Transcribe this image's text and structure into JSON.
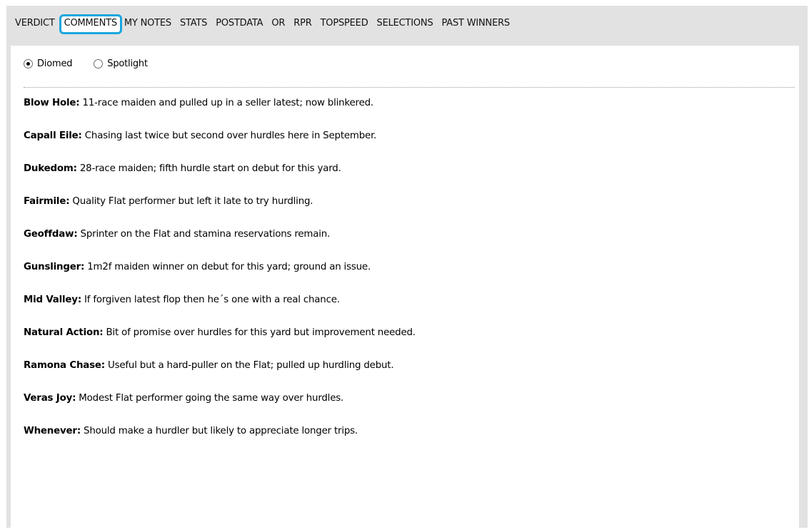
{
  "tabs": [
    {
      "label": "VERDICT",
      "selected": false
    },
    {
      "label": "COMMENTS",
      "selected": true
    },
    {
      "label": "MY NOTES",
      "selected": false
    },
    {
      "label": "STATS",
      "selected": false
    },
    {
      "label": "POSTDATA",
      "selected": false
    },
    {
      "label": "OR",
      "selected": false
    },
    {
      "label": "RPR",
      "selected": false
    },
    {
      "label": "TOPSPEED",
      "selected": false
    },
    {
      "label": "SELECTIONS",
      "selected": false
    },
    {
      "label": "PAST WINNERS",
      "selected": false
    }
  ],
  "source_options": [
    {
      "label": "Diomed",
      "checked": true
    },
    {
      "label": "Spotlight",
      "checked": false
    }
  ],
  "comments": [
    {
      "horse": "Blow Hole:",
      "text": " 11-race maiden and pulled up in a seller latest; now blinkered."
    },
    {
      "horse": "Capall Eile:",
      "text": " Chasing last twice but second over hurdles here in September."
    },
    {
      "horse": "Dukedom:",
      "text": " 28-race maiden; fifth hurdle start on debut for this yard."
    },
    {
      "horse": "Fairmile:",
      "text": " Quality Flat performer but left it late to try hurdling."
    },
    {
      "horse": "Geoffdaw:",
      "text": " Sprinter on the Flat and stamina reservations remain."
    },
    {
      "horse": "Gunslinger:",
      "text": " 1m2f maiden winner on debut for this yard; ground an issue."
    },
    {
      "horse": "Mid Valley:",
      "text": " If forgiven latest flop then he´s one with a real chance."
    },
    {
      "horse": "Natural Action:",
      "text": " Bit of promise over hurdles for this yard but improvement needed."
    },
    {
      "horse": "Ramona Chase:",
      "text": " Useful but a hard-puller on the Flat; pulled up hurdling debut."
    },
    {
      "horse": "Veras Joy:",
      "text": " Modest Flat performer going the same way over hurdles."
    },
    {
      "horse": "Whenever:",
      "text": " Should make a hurdler but likely to appreciate longer trips."
    }
  ],
  "colors": {
    "frame_background": "#e2e2e2",
    "selected_tab_outline": "#1aa6e0"
  }
}
